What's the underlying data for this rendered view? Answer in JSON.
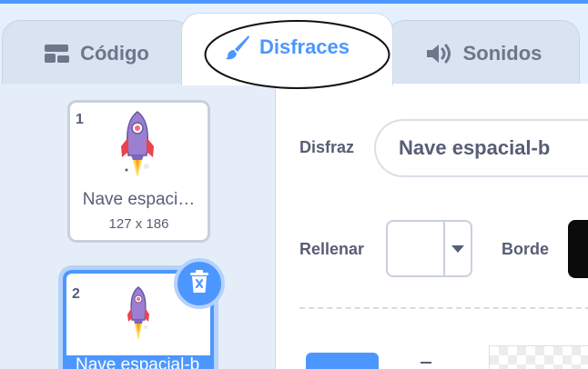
{
  "tabs": [
    {
      "label": "Código",
      "icon": "code-blocks-icon",
      "active": false
    },
    {
      "label": "Disfraces",
      "icon": "paintbrush-icon",
      "active": true
    },
    {
      "label": "Sonidos",
      "icon": "speaker-icon",
      "active": false
    }
  ],
  "costumes": [
    {
      "number": "1",
      "name": "Nave espaci…",
      "size": "127 x 186",
      "selected": false
    },
    {
      "number": "2",
      "name": "Nave espacial-b",
      "selected": true
    }
  ],
  "editor": {
    "costume_label": "Disfraz",
    "costume_name": "Nave espacial-b",
    "fill_label": "Rellenar",
    "outline_label": "Borde",
    "fill_color": "#ffffff",
    "outline_color": "#0b0b0b"
  },
  "colors": {
    "accent": "#4c97ff",
    "panel_bg": "#e5f0ff",
    "text": "#575e75"
  }
}
